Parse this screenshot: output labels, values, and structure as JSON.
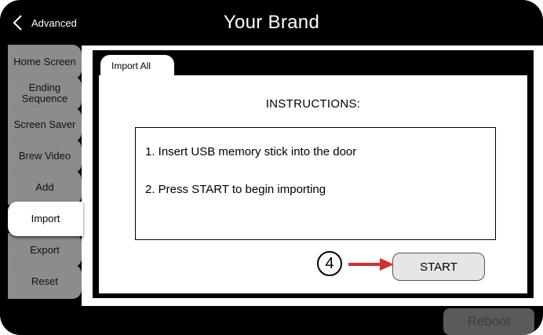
{
  "header": {
    "title": "Your Brand",
    "back_label": "Advanced",
    "back_icon": "chevron-left-icon"
  },
  "sidebar": {
    "items": [
      {
        "label": "Home Screen",
        "active": false
      },
      {
        "label": "Ending Sequence",
        "active": false
      },
      {
        "label": "Screen Saver",
        "active": false
      },
      {
        "label": "Brew Video",
        "active": false
      },
      {
        "label": "Add",
        "active": false
      },
      {
        "label": "Import",
        "active": true
      },
      {
        "label": "Export",
        "active": false
      },
      {
        "label": "Reset",
        "active": false
      }
    ]
  },
  "panel": {
    "tab_label": "Import All",
    "instructions_title": "INSTRUCTIONS:",
    "steps": [
      "1.  Insert USB memory stick into the door",
      "2.  Press START to begin importing"
    ],
    "start_label": "START",
    "callout_number": "4",
    "callout_color": "#d32f2f"
  },
  "footer": {
    "reboot_label": "Reboot"
  },
  "colors": {
    "frame": "#000000",
    "tab_inactive": "#8c8c8c",
    "tab_active": "#ffffff",
    "button": "#e6e6e6"
  }
}
